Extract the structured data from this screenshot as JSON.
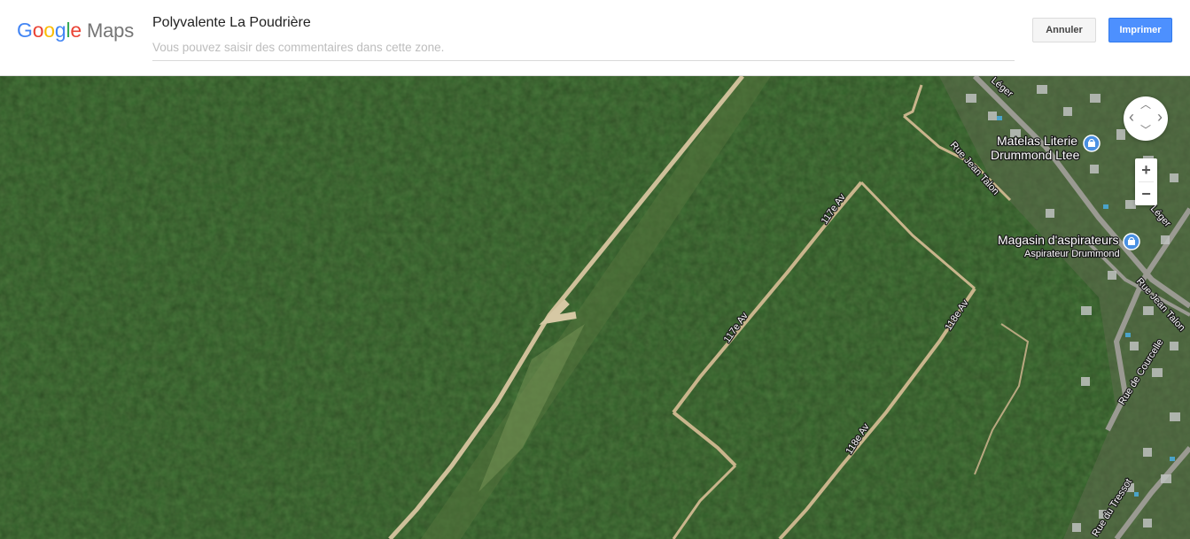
{
  "header": {
    "logo_letters": [
      "G",
      "o",
      "o",
      "g",
      "l",
      "e"
    ],
    "logo_maps": "Maps",
    "title": "Polyvalente La Poudrière",
    "comment_placeholder": "Vous pouvez saisir des commentaires dans cette zone.",
    "cancel_label": "Annuler",
    "print_label": "Imprimer"
  },
  "map": {
    "view": "satellite",
    "roads": {
      "av117_upper": "117e Av",
      "av117_lower": "117e Av",
      "av118_upper": "118e Av",
      "av118_lower": "118e Av",
      "jean_talon_upper": "Rue Jean Talon",
      "jean_talon_lower": "Rue Jean Talon",
      "leger_top": "Léger",
      "leger_right": "Léger",
      "courcelle": "Rue de Courcelle",
      "tressot": "Rue du Tressot"
    },
    "pois": {
      "matelas_line1": "Matelas Literie",
      "matelas_line2": "Drummond Ltee",
      "magasin_name": "Magasin d'aspirateurs",
      "magasin_sub": "Aspirateur Drummond",
      "poi_icon": "shopping-bag-icon"
    },
    "controls": {
      "zoom_in": "+",
      "zoom_out": "−",
      "rotate_up": "︿",
      "rotate_down": "﹀",
      "rotate_left": "‹",
      "rotate_right": "›"
    },
    "colors": {
      "poi_blue": "#4a90e2",
      "primary_button": "#4d90fe"
    }
  }
}
